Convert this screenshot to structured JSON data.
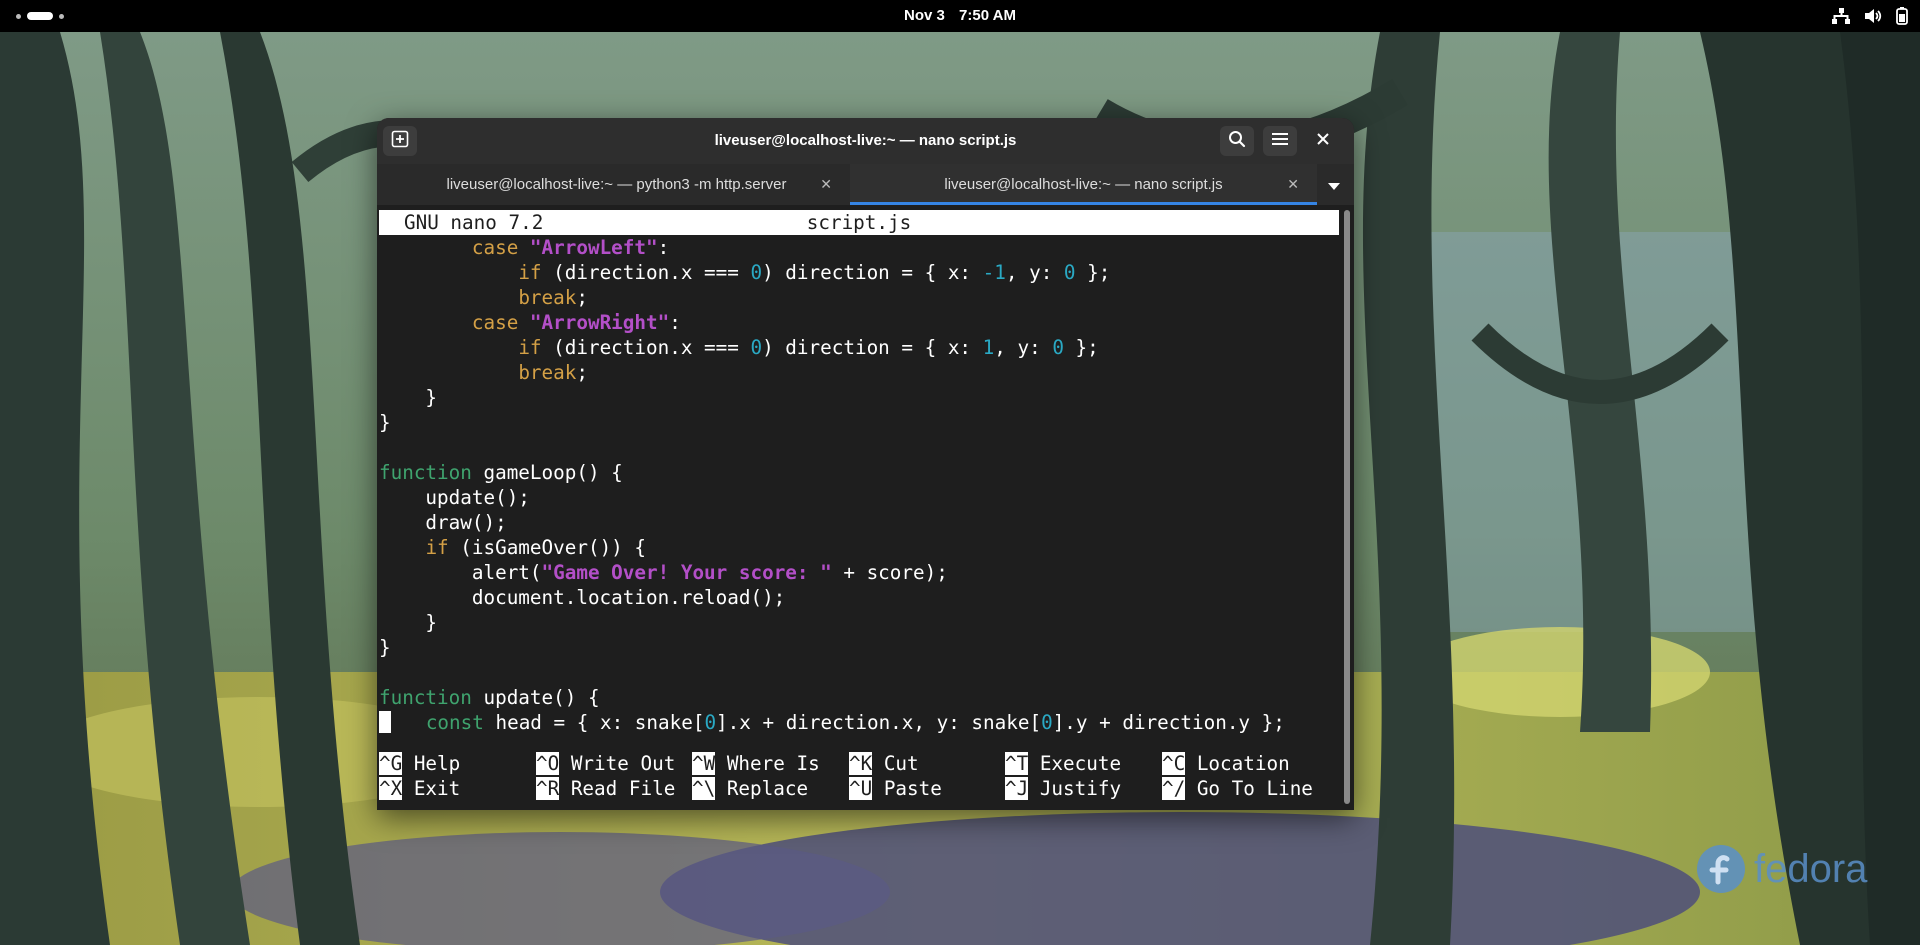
{
  "topbar": {
    "date": "Nov 3",
    "time": "7:50 AM"
  },
  "window": {
    "title": "liveuser@localhost-live:~ — nano script.js",
    "tabs": [
      {
        "label": "liveuser@localhost-live:~ — python3 -m http.server",
        "active": false
      },
      {
        "label": "liveuser@localhost-live:~ — nano script.js",
        "active": true
      }
    ]
  },
  "nano": {
    "version": "GNU nano 7.2",
    "filename": "script.js",
    "code_lines": [
      [
        {
          "t": "        "
        },
        {
          "t": "case",
          "c": "kw"
        },
        {
          "t": " "
        },
        {
          "t": "\"ArrowLeft\"",
          "c": "str"
        },
        {
          "t": ":"
        }
      ],
      [
        {
          "t": "            "
        },
        {
          "t": "if",
          "c": "kw"
        },
        {
          "t": " (direction.x === "
        },
        {
          "t": "0",
          "c": "num"
        },
        {
          "t": ") direction = { x: "
        },
        {
          "t": "-1",
          "c": "num"
        },
        {
          "t": ", y: "
        },
        {
          "t": "0",
          "c": "num"
        },
        {
          "t": " };"
        }
      ],
      [
        {
          "t": "            "
        },
        {
          "t": "break",
          "c": "kw"
        },
        {
          "t": ";"
        }
      ],
      [
        {
          "t": "        "
        },
        {
          "t": "case",
          "c": "kw"
        },
        {
          "t": " "
        },
        {
          "t": "\"ArrowRight\"",
          "c": "str"
        },
        {
          "t": ":"
        }
      ],
      [
        {
          "t": "            "
        },
        {
          "t": "if",
          "c": "kw"
        },
        {
          "t": " (direction.x === "
        },
        {
          "t": "0",
          "c": "num"
        },
        {
          "t": ") direction = { x: "
        },
        {
          "t": "1",
          "c": "num"
        },
        {
          "t": ", y: "
        },
        {
          "t": "0",
          "c": "num"
        },
        {
          "t": " };"
        }
      ],
      [
        {
          "t": "            "
        },
        {
          "t": "break",
          "c": "kw"
        },
        {
          "t": ";"
        }
      ],
      [
        {
          "t": "    }"
        }
      ],
      [
        {
          "t": "}"
        }
      ],
      [
        {
          "t": ""
        }
      ],
      [
        {
          "t": "function",
          "c": "fn"
        },
        {
          "t": " gameLoop() {"
        }
      ],
      [
        {
          "t": "    update();"
        }
      ],
      [
        {
          "t": "    draw();"
        }
      ],
      [
        {
          "t": "    "
        },
        {
          "t": "if",
          "c": "kw"
        },
        {
          "t": " (isGameOver()) {"
        }
      ],
      [
        {
          "t": "        alert("
        },
        {
          "t": "\"Game Over! Your score: \"",
          "c": "str"
        },
        {
          "t": " + score);"
        }
      ],
      [
        {
          "t": "        document.location.reload();"
        }
      ],
      [
        {
          "t": "    }"
        }
      ],
      [
        {
          "t": "}"
        }
      ],
      [
        {
          "t": ""
        }
      ],
      [
        {
          "t": "function",
          "c": "fn"
        },
        {
          "t": " update() {"
        }
      ],
      [
        {
          "t": "",
          "c": "cursor"
        },
        {
          "t": "   "
        },
        {
          "t": "const",
          "c": "fn"
        },
        {
          "t": " head = { x: snake["
        },
        {
          "t": "0",
          "c": "num"
        },
        {
          "t": "].x + direction.x, y: snake["
        },
        {
          "t": "0",
          "c": "num"
        },
        {
          "t": "].y + direction.y };"
        }
      ]
    ],
    "shortcuts": [
      [
        {
          "key": "^G",
          "label": "Help"
        },
        {
          "key": "^O",
          "label": "Write Out"
        },
        {
          "key": "^W",
          "label": "Where Is"
        },
        {
          "key": "^K",
          "label": "Cut"
        },
        {
          "key": "^T",
          "label": "Execute"
        },
        {
          "key": "^C",
          "label": "Location"
        }
      ],
      [
        {
          "key": "^X",
          "label": "Exit"
        },
        {
          "key": "^R",
          "label": "Read File"
        },
        {
          "key": "^\\",
          "label": "Replace"
        },
        {
          "key": "^U",
          "label": "Paste"
        },
        {
          "key": "^J",
          "label": "Justify"
        },
        {
          "key": "^/",
          "label": "Go To Line"
        }
      ]
    ]
  },
  "wallpaper": {
    "logo_text": "fedora"
  },
  "icons": {
    "new_tab": "new-tab-icon",
    "search": "search-icon",
    "menu": "hamburger-menu-icon",
    "close": "close-icon",
    "tab_dropdown": "chevron-down-icon",
    "network": "network-icon",
    "volume": "volume-icon",
    "battery": "battery-icon"
  }
}
